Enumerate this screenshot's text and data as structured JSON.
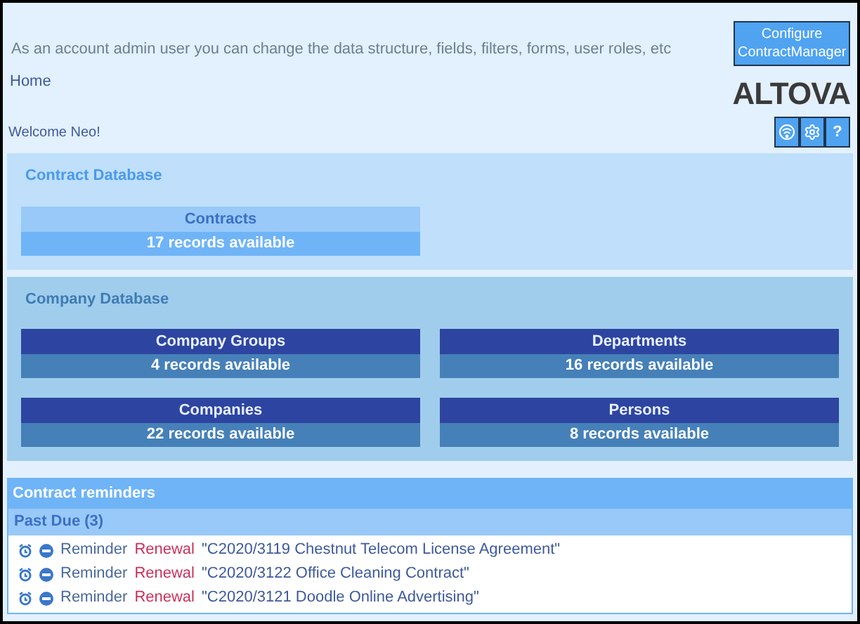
{
  "header": {
    "message": "As an account admin user you can change the data structure, fields, filters, forms, user roles, etc",
    "configure_button": "Configure ContractManager",
    "breadcrumb": "Home",
    "logo": "ALTOVA",
    "welcome": "Welcome Neo!",
    "help_button": "?"
  },
  "sections": [
    {
      "title": "Contract Database",
      "kind": "contract",
      "tiles": [
        {
          "name": "Contracts",
          "records": "17 records available"
        }
      ]
    },
    {
      "title": "Company Database",
      "kind": "company",
      "tiles": [
        {
          "name": "Company Groups",
          "records": "4 records available"
        },
        {
          "name": "Departments",
          "records": "16 records available"
        },
        {
          "name": "Companies",
          "records": "22 records available"
        },
        {
          "name": "Persons",
          "records": "8 records available"
        }
      ]
    }
  ],
  "reminders": {
    "title": "Contract reminders",
    "group": "Past Due (3)",
    "items": [
      {
        "label": "Reminder",
        "type": "Renewal",
        "contract": "\"C2020/3119 Chestnut Telecom License Agreement\""
      },
      {
        "label": "Reminder",
        "type": "Renewal",
        "contract": "\"C2020/3122 Office Cleaning Contract\""
      },
      {
        "label": "Reminder",
        "type": "Renewal",
        "contract": "\"C2020/3121 Doodle Online Advertising\""
      }
    ]
  }
}
